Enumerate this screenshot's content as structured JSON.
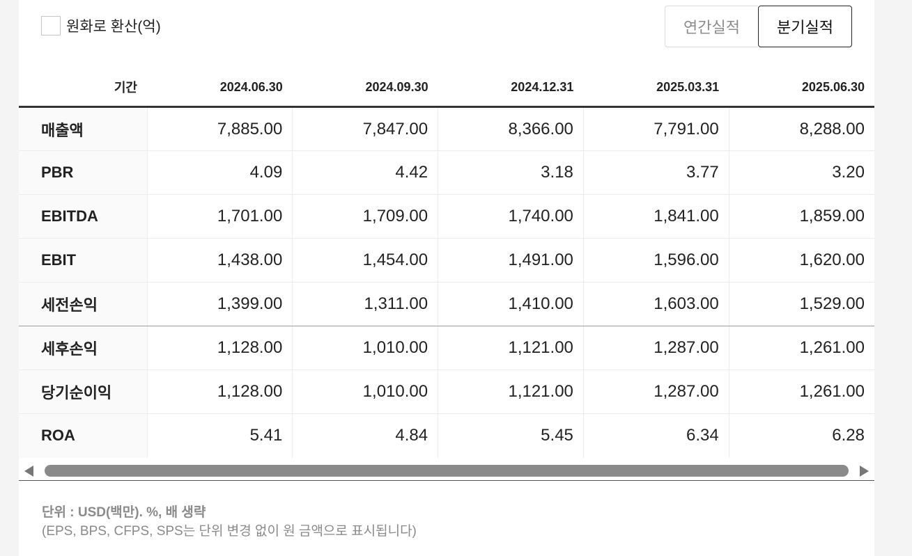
{
  "controls": {
    "convert_checkbox_label": "원화로 환산(억)",
    "convert_checked": false,
    "tabs": [
      {
        "label": "연간실적",
        "active": false
      },
      {
        "label": "분기실적",
        "active": true
      }
    ]
  },
  "table": {
    "period_header": "기간",
    "columns": [
      "2024.06.30",
      "2024.09.30",
      "2024.12.31",
      "2025.03.31",
      "2025.06.30"
    ],
    "rows": [
      {
        "label": "매출액",
        "values": [
          "7,885.00",
          "7,847.00",
          "8,366.00",
          "7,791.00",
          "8,288.00"
        ]
      },
      {
        "label": "PBR",
        "values": [
          "4.09",
          "4.42",
          "3.18",
          "3.77",
          "3.20"
        ]
      },
      {
        "label": "EBITDA",
        "values": [
          "1,701.00",
          "1,709.00",
          "1,740.00",
          "1,841.00",
          "1,859.00"
        ]
      },
      {
        "label": "EBIT",
        "values": [
          "1,438.00",
          "1,454.00",
          "1,491.00",
          "1,596.00",
          "1,620.00"
        ]
      },
      {
        "label": "세전손익",
        "values": [
          "1,399.00",
          "1,311.00",
          "1,410.00",
          "1,603.00",
          "1,529.00"
        ]
      },
      {
        "label": "세후손익",
        "values": [
          "1,128.00",
          "1,010.00",
          "1,121.00",
          "1,287.00",
          "1,261.00"
        ]
      },
      {
        "label": "당기순이익",
        "values": [
          "1,128.00",
          "1,010.00",
          "1,121.00",
          "1,287.00",
          "1,261.00"
        ]
      },
      {
        "label": "ROA",
        "values": [
          "5.41",
          "4.84",
          "5.45",
          "6.34",
          "6.28"
        ]
      }
    ]
  },
  "footnote": {
    "unit": "단위 : USD(백만). %, 배 생략",
    "note": "(EPS, BPS, CFPS, SPS는 단위 변경 없이 원 금액으로 표시됩니다)"
  },
  "icons": {
    "scroll_left": "triangle-left-icon",
    "scroll_right": "triangle-right-icon"
  }
}
